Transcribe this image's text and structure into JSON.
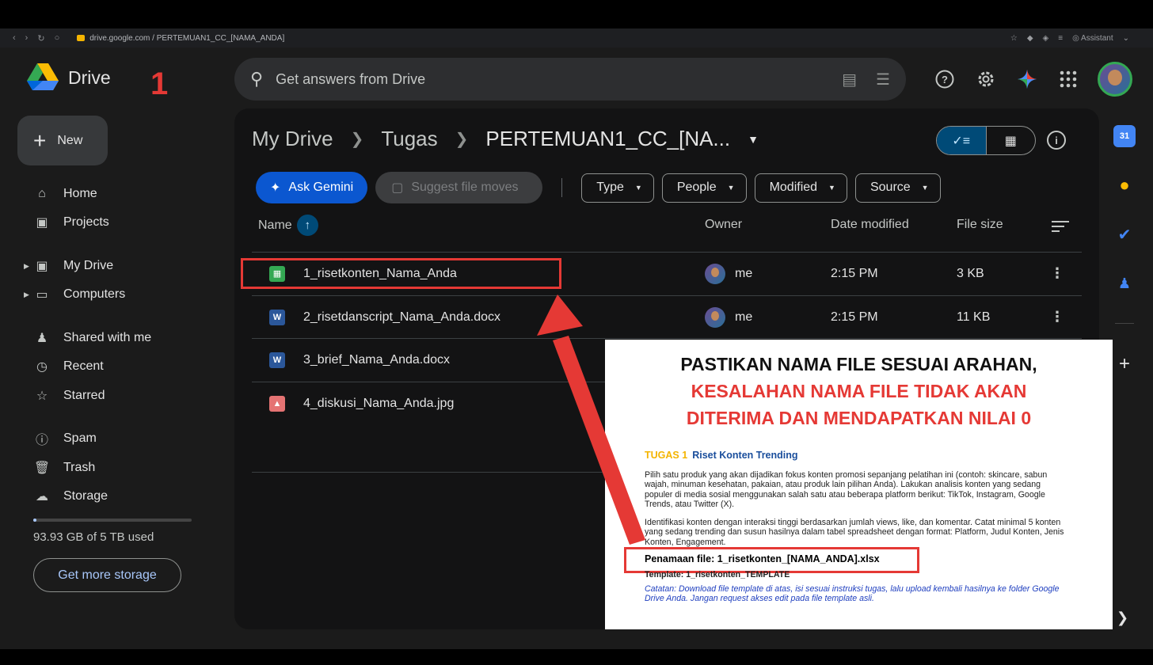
{
  "browser": {
    "url": "drive.google.com / PERTEMUAN1_CC_[NAMA_ANDA]",
    "assistant_label": "Assistant"
  },
  "annotation": {
    "step_number": "1"
  },
  "app": {
    "logo_text": "Drive",
    "search_placeholder": "Get answers from Drive"
  },
  "sidebar": {
    "new_label": "New",
    "items": [
      {
        "label": "Home",
        "icon": "home-icon"
      },
      {
        "label": "Projects",
        "icon": "projects-icon"
      },
      {
        "label": "My Drive",
        "icon": "my-drive-icon"
      },
      {
        "label": "Computers",
        "icon": "computers-icon"
      },
      {
        "label": "Shared with me",
        "icon": "shared-icon"
      },
      {
        "label": "Recent",
        "icon": "clock-icon"
      },
      {
        "label": "Starred",
        "icon": "star-icon"
      },
      {
        "label": "Spam",
        "icon": "spam-icon"
      },
      {
        "label": "Trash",
        "icon": "trash-icon"
      },
      {
        "label": "Storage",
        "icon": "cloud-icon"
      }
    ],
    "storage_text": "93.93 GB of 5 TB used",
    "storage_fraction": 0.02,
    "get_storage_label": "Get more storage"
  },
  "breadcrumb": {
    "root": "My Drive",
    "parent": "Tugas",
    "current": "PERTEMUAN1_CC_[NA..."
  },
  "filters": {
    "ask_gemini": "Ask Gemini",
    "suggest_moves": "Suggest file moves",
    "type": "Type",
    "people": "People",
    "modified": "Modified",
    "source": "Source"
  },
  "table": {
    "headers": {
      "name": "Name",
      "owner": "Owner",
      "date": "Date modified",
      "size": "File size"
    },
    "rows": [
      {
        "name": "1_risetkonten_Nama_Anda",
        "type": "sheet",
        "owner": "me",
        "date": "2:15 PM",
        "size": "3 KB"
      },
      {
        "name": "2_risetdanscript_Nama_Anda.docx",
        "type": "word",
        "owner": "me",
        "date": "2:15 PM",
        "size": "11 KB"
      },
      {
        "name": "3_brief_Nama_Anda.docx",
        "type": "word",
        "owner": "",
        "date": "",
        "size": ""
      },
      {
        "name": "4_diskusi_Nama_Anda.jpg",
        "type": "image",
        "owner": "",
        "date": "",
        "size": ""
      }
    ]
  },
  "overlay": {
    "heading_line1": "PASTIKAN NAMA FILE SESUAI ARAHAN,",
    "heading_line2": "KESALAHAN NAMA FILE TIDAK AKAN",
    "heading_line3": "DITERIMA DAN MENDAPATKAN NILAI 0",
    "task_number": "TUGAS 1",
    "task_name": "Riset Konten Trending",
    "para1": "Pilih satu produk yang akan dijadikan fokus konten promosi sepanjang pelatihan ini (contoh: skincare, sabun wajah, minuman kesehatan, pakaian, atau produk lain pilihan Anda). Lakukan analisis konten yang sedang populer di media sosial menggunakan salah satu atau beberapa platform berikut: TikTok, Instagram, Google Trends, atau Twitter (X).",
    "para2": "Identifikasi konten dengan interaksi tinggi berdasarkan jumlah views, like, dan komentar. Catat minimal 5 konten yang sedang trending dan susun hasilnya dalam tabel spreadsheet dengan format: Platform, Judul Konten, Jenis Konten, Engagement.",
    "filename_rule": "Penamaan file: 1_risetkonten_[NAMA_ANDA].xlsx",
    "template_line": "Template: 1_risetkonten_TEMPLATE",
    "note": "Catatan: Download file template di atas, isi sesuai instruksi tugas, lalu upload kembali hasilnya ke folder Google Drive Anda. Jangan request akses edit pada file template asli."
  },
  "colors": {
    "accent_red": "#e53935",
    "gemini_blue": "#0b57d0",
    "task_yellow": "#f4b400"
  }
}
